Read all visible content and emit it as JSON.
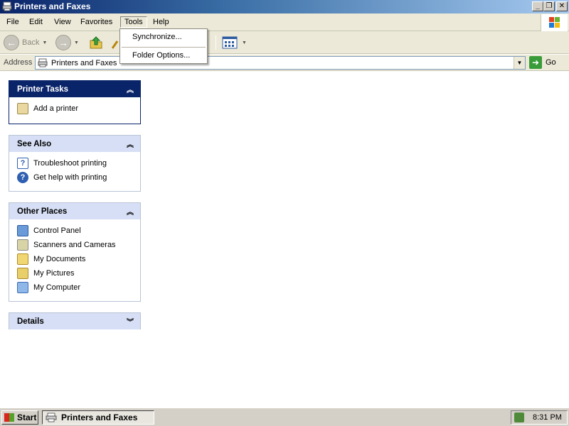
{
  "window": {
    "title": "Printers and Faxes"
  },
  "menu": {
    "items": [
      "File",
      "Edit",
      "View",
      "Favorites",
      "Tools",
      "Help"
    ]
  },
  "toolbar": {
    "back_label": "Back"
  },
  "tools_menu": {
    "items": [
      "Synchronize...",
      "Folder Options..."
    ]
  },
  "address": {
    "label": "Address",
    "value": "Printers and Faxes",
    "go_label": "Go"
  },
  "panes": {
    "printer_tasks": {
      "title": "Printer Tasks",
      "items": [
        {
          "label": "Add a printer",
          "icon": "add-printer-icon"
        }
      ]
    },
    "see_also": {
      "title": "See Also",
      "items": [
        {
          "label": "Troubleshoot printing",
          "icon": "help-book-icon"
        },
        {
          "label": "Get help with printing",
          "icon": "help-icon"
        }
      ]
    },
    "other_places": {
      "title": "Other Places",
      "items": [
        {
          "label": "Control Panel",
          "icon": "control-panel-icon"
        },
        {
          "label": "Scanners and Cameras",
          "icon": "scanner-icon"
        },
        {
          "label": "My Documents",
          "icon": "my-documents-icon"
        },
        {
          "label": "My Pictures",
          "icon": "my-pictures-icon"
        },
        {
          "label": "My Computer",
          "icon": "my-computer-icon"
        }
      ]
    },
    "details": {
      "title": "Details"
    }
  },
  "taskbar": {
    "start_label": "Start",
    "task_label": "Printers and Faxes",
    "clock": "8:31 PM"
  }
}
